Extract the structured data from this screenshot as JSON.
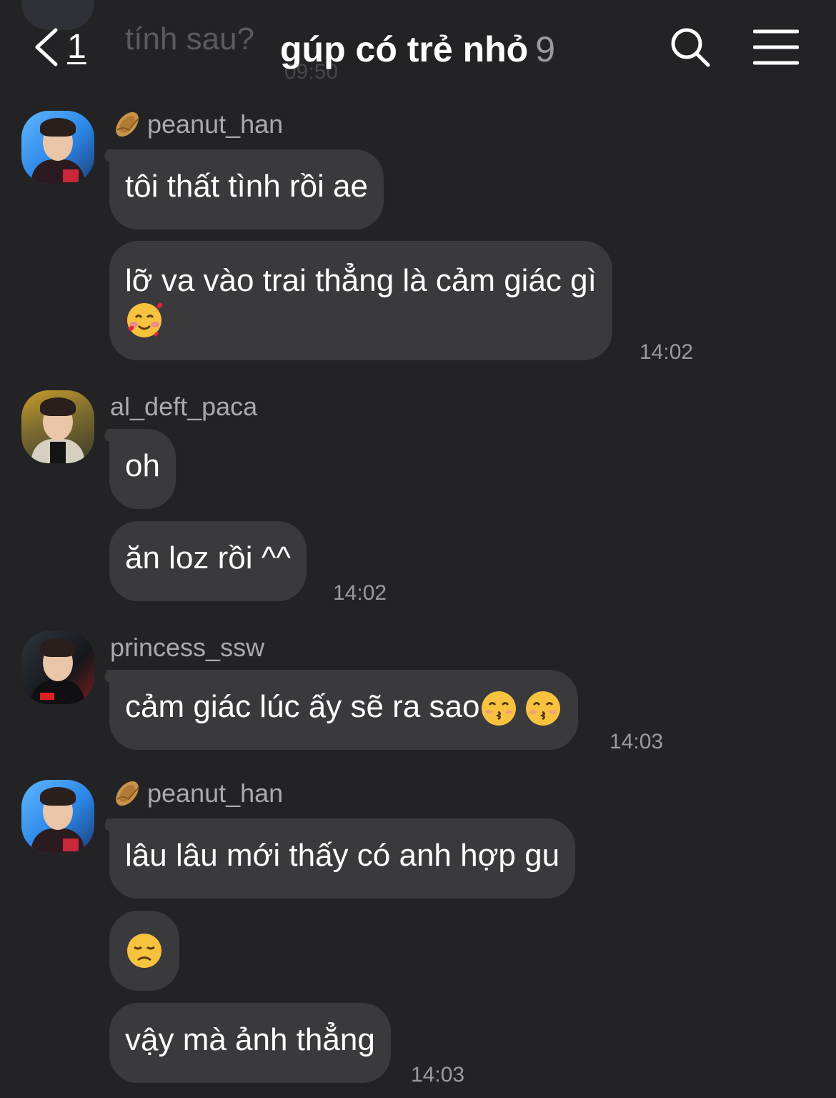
{
  "header": {
    "back_count": "1",
    "title": "gúp có trẻ nhỏ",
    "member_count": "9",
    "search_icon": "search-icon",
    "menu_icon": "hamburger-menu-icon"
  },
  "previous": {
    "text": "tính sau?",
    "time": "09:50"
  },
  "messages": [
    {
      "sender": "peanut_han",
      "bubbles": [
        "tôi thất tình rồi ae",
        "lỡ va vào trai thẳng là cảm giác gì"
      ],
      "emoji_second": "smiling-face-with-hearts",
      "time": "14:02"
    },
    {
      "sender": "al_deft_paca",
      "bubbles": [
        "oh",
        "ăn loz rồi ^^"
      ],
      "time": "14:02"
    },
    {
      "sender": "princess_ssw",
      "bubbles": [
        "cảm giác lúc ấy sẽ ra sao"
      ],
      "emojis": [
        "kissing-face-with-smiling-eyes",
        "kissing-face-with-smiling-eyes"
      ],
      "time": "14:03"
    },
    {
      "sender": "peanut_han",
      "bubbles": [
        "lâu lâu mới thấy có anh hợp gu",
        "",
        "vậy mà ảnh thẳng"
      ],
      "emoji_second": "disappointed-face",
      "time": "14:03"
    }
  ],
  "colors": {
    "background": "#232326",
    "bubble": "#3a3a3d",
    "secondary_text": "#9a9aa0"
  }
}
